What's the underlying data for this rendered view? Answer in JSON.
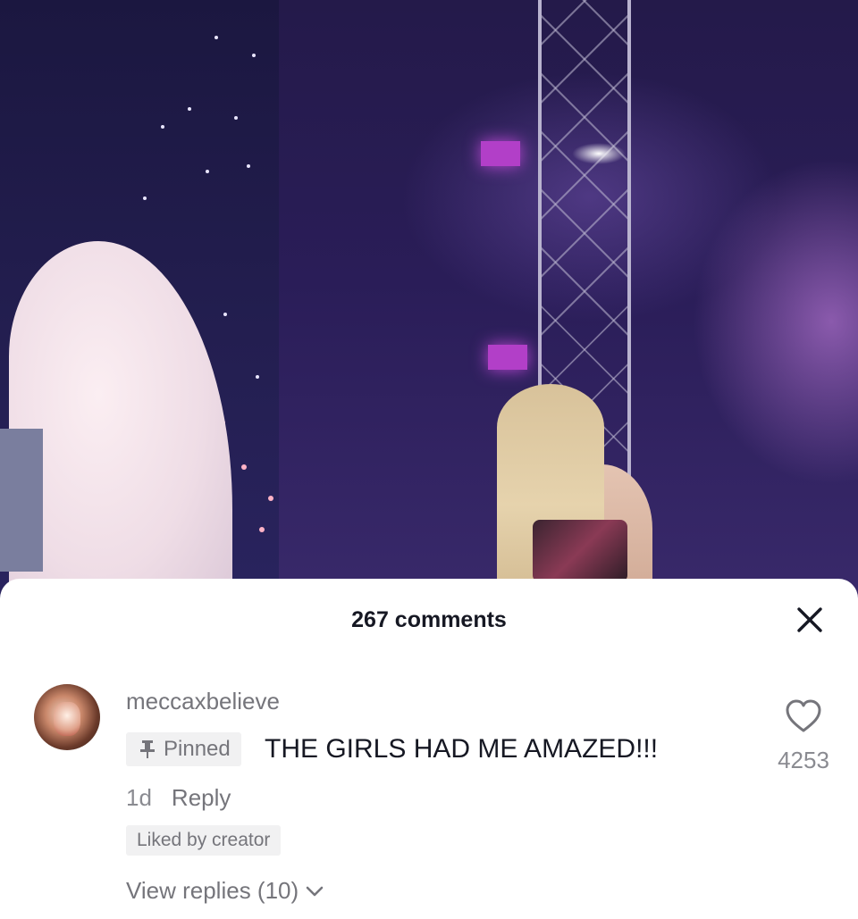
{
  "comments_panel": {
    "title": "267 comments",
    "close_icon": "close-icon"
  },
  "pinned_comment": {
    "username": "meccaxbelieve",
    "pinned_label": "Pinned",
    "text": "THE GIRLS HAD ME AMAZED!!!",
    "age": "1d",
    "reply_label": "Reply",
    "liked_by_creator_label": "Liked by creator",
    "view_replies_label": "View replies (10)",
    "like_count": "4253",
    "icons": {
      "avatar": "avatar",
      "pin": "pin-icon",
      "heart": "heart-icon",
      "chevron": "chevron-down-icon"
    }
  },
  "colors": {
    "primary_text": "#161823",
    "secondary_text": "#75757b",
    "badge_background": "#f1f1f2",
    "sheet_background": "#ffffff"
  }
}
